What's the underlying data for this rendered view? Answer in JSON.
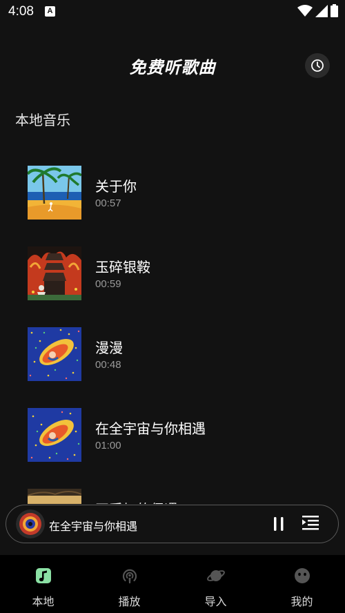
{
  "status_bar": {
    "time": "4:08",
    "notification_letter": "A"
  },
  "header": {
    "title": "免费听歌曲"
  },
  "section": {
    "title": "本地音乐"
  },
  "songs": [
    {
      "title": "关于你",
      "duration": "00:57"
    },
    {
      "title": "玉碎银鞍",
      "duration": "00:59"
    },
    {
      "title": "漫漫",
      "duration": "00:48"
    },
    {
      "title": "在全宇宙与你相遇",
      "duration": "01:00"
    },
    {
      "title": "开采加的偶遇",
      "duration": ""
    }
  ],
  "mini_player": {
    "title": "在全宇宙与你相遇"
  },
  "nav": [
    {
      "label": "本地",
      "icon": "music-note-icon"
    },
    {
      "label": "播放",
      "icon": "podcast-icon"
    },
    {
      "label": "导入",
      "icon": "planet-icon"
    },
    {
      "label": "我的",
      "icon": "face-icon"
    }
  ],
  "colors": {
    "background": "#121212",
    "nav_background": "#000000",
    "accent": "#8be0a4",
    "muted": "#9a9a9a"
  }
}
